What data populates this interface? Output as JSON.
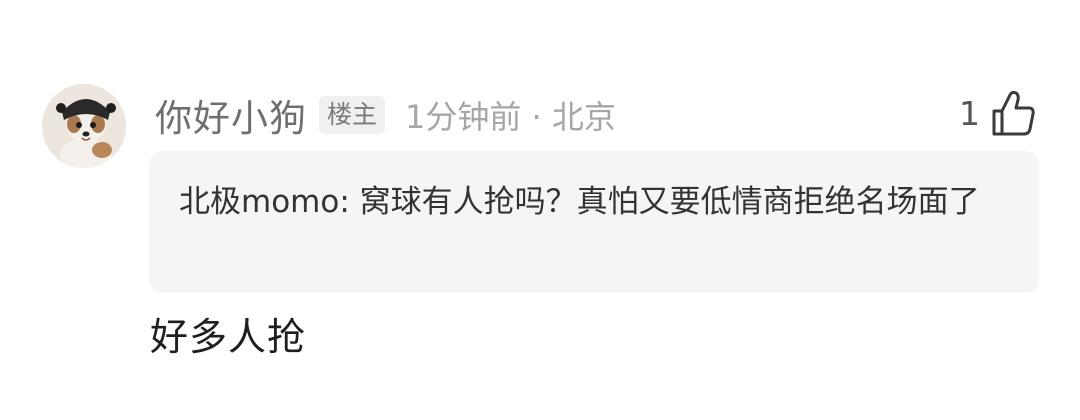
{
  "comment": {
    "username": "你好小狗",
    "badge": "楼主",
    "time": "1分钟前",
    "separator": "·",
    "location": "北京",
    "meta_text": "1分钟前 · 北京",
    "like_count": "1",
    "like_icon": "thumbs-up-icon",
    "avatar_icon": "dog-avatar",
    "quoted": {
      "author": "北极momo",
      "text": "北极momo: 窝球有人抢吗？真怕又要低情商拒绝名场面了"
    },
    "reply": "好多人抢"
  },
  "colors": {
    "quote_bg": "#f5f5f5",
    "username": "#6f6f6f",
    "meta": "#a6a6a6",
    "badge_bg": "#f0f0f0"
  }
}
